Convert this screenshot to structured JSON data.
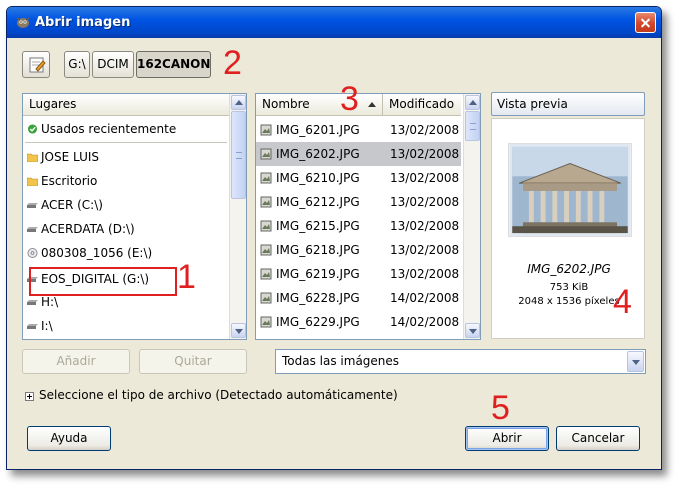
{
  "window": {
    "title": "Abrir imagen"
  },
  "path_bar": {
    "buttons": [
      "G:\\",
      "DCIM",
      "162CANON"
    ]
  },
  "places": {
    "header": "Lugares",
    "items": [
      {
        "label": "Usados recientemente",
        "icon": "recent-icon"
      },
      {
        "label": "JOSE LUIS",
        "icon": "folder-icon"
      },
      {
        "label": "Escritorio",
        "icon": "folder-icon"
      },
      {
        "label": "ACER (C:\\)",
        "icon": "drive-icon"
      },
      {
        "label": "ACERDATA (D:\\)",
        "icon": "drive-icon"
      },
      {
        "label": "080308_1056 (E:\\)",
        "icon": "cdrom-icon"
      },
      {
        "label": "EOS_DIGITAL (G:\\)",
        "icon": "drive-icon"
      },
      {
        "label": "H:\\",
        "icon": "drive-icon"
      },
      {
        "label": "I:\\",
        "icon": "drive-icon"
      }
    ]
  },
  "files": {
    "headers": {
      "name": "Nombre",
      "modified": "Modificado"
    },
    "rows": [
      {
        "name": "IMG_6201.JPG",
        "date": "13/02/2008",
        "selected": false
      },
      {
        "name": "IMG_6202.JPG",
        "date": "13/02/2008",
        "selected": true
      },
      {
        "name": "IMG_6210.JPG",
        "date": "13/02/2008",
        "selected": false
      },
      {
        "name": "IMG_6212.JPG",
        "date": "13/02/2008",
        "selected": false
      },
      {
        "name": "IMG_6215.JPG",
        "date": "13/02/2008",
        "selected": false
      },
      {
        "name": "IMG_6218.JPG",
        "date": "13/02/2008",
        "selected": false
      },
      {
        "name": "IMG_6219.JPG",
        "date": "13/02/2008",
        "selected": false
      },
      {
        "name": "IMG_6228.JPG",
        "date": "14/02/2008",
        "selected": false
      },
      {
        "name": "IMG_6229.JPG",
        "date": "14/02/2008",
        "selected": false
      }
    ]
  },
  "preview": {
    "button_label": "Vista previa",
    "filename": "IMG_6202.JPG",
    "size": "753 KiB",
    "dimensions": "2048 x 1536 píxeles"
  },
  "places_buttons": {
    "add": "Añadir",
    "remove": "Quitar"
  },
  "filter": {
    "selected": "Todas las imágenes"
  },
  "filetype_expander": "Seleccione el tipo de archivo (Detectado automáticamente)",
  "footer": {
    "help": "Ayuda",
    "open": "Abrir",
    "cancel": "Cancelar"
  },
  "annotations": [
    "1",
    "2",
    "3",
    "4",
    "5"
  ],
  "colors": {
    "titlebar": "#0054e3",
    "annotation": "#e02020",
    "selection": "#c7c8cc",
    "dialog_bg": "#ece9d8"
  }
}
